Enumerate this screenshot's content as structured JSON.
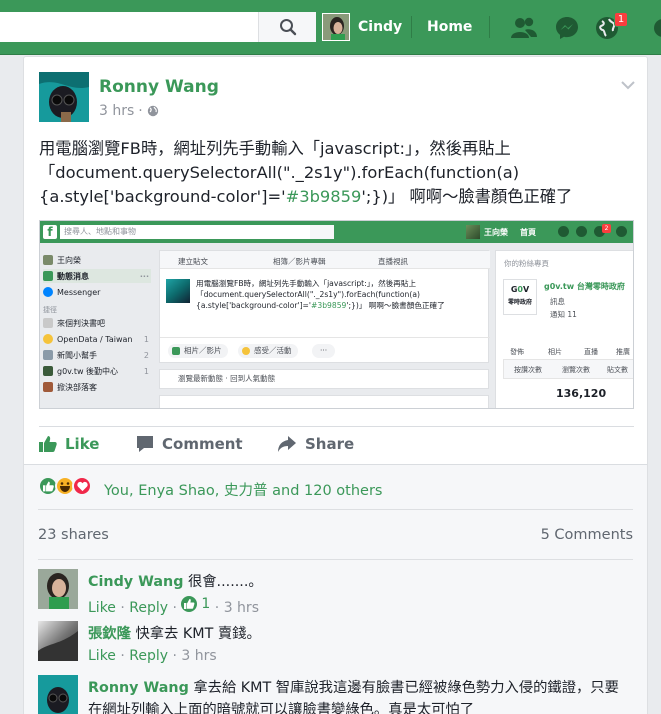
{
  "topbar": {
    "user_name": "Cindy",
    "home_label": "Home",
    "notification_count": "1"
  },
  "post": {
    "author": "Ronny Wang",
    "time": "3 hrs",
    "text_before": "用電腦瀏覽FB時，網址列先手動輸入「javascript:」，然後再貼上「document.querySelectorAll(\"._2s1y\").forEach(function(a){a.style['background-color']='",
    "text_color": "#3b9859",
    "text_after": "';})」 啊啊～臉書顏色正確了"
  },
  "embedded": {
    "search_placeholder": "搜尋人、地點和事物",
    "user_name": "王向榮",
    "home": "首頁",
    "badge": "2",
    "left_items": [
      {
        "label": "王向榮",
        "num": ""
      },
      {
        "label": "動態消息",
        "num": "···"
      },
      {
        "label": "Messenger",
        "num": ""
      },
      {
        "label": "捷徑",
        "num": ""
      },
      {
        "label": "來個判決書吧",
        "num": ""
      },
      {
        "label": "OpenData / Taiwan",
        "num": "1"
      },
      {
        "label": "新聞小幫手",
        "num": "2"
      },
      {
        "label": "g0v.tw 後勤中心",
        "num": "1"
      },
      {
        "label": "掀決部落客",
        "num": ""
      }
    ],
    "composer_tabs": [
      "建立貼文",
      "相簿／影片專輯",
      "直播視訊"
    ],
    "post_text_before": "用電腦瀏覽FB時，網址列先手動輸入「javascript:」，然後再貼上「document.querySelectorAll(\"._2s1y\").forEach(function(a){a.style['background-color']='",
    "post_text_color": "#3b9859",
    "post_text_after": "';})」 啊啊～臉書顏色正確了",
    "btn_photo": "相片／影片",
    "btn_feeling": "感受／活動",
    "btn_more": "···",
    "feed_option": "瀏覽最新動態 · 回到人氣動態",
    "right_header": "你的粉絲專頁",
    "page_logo": "G0V\n零時政府",
    "page_name": "g0v.tw 台灣零時政府",
    "page_category": "訊息",
    "page_notifications": "通知 11",
    "page_actions": [
      "發佈",
      "相片",
      "直播",
      "推廣"
    ],
    "stat_tabs": [
      "按讚次數",
      "瀏覽次數",
      "貼文數"
    ],
    "likes_count": "136,120"
  },
  "actions": {
    "like": "Like",
    "comment": "Comment",
    "share": "Share"
  },
  "reactions_text": "You, Enya Shao, 史力普 and 120 others",
  "shares": "23 shares",
  "comments_count": "5 Comments",
  "comments": [
    {
      "name": "Cindy Wang",
      "text": "很會.......。",
      "like": "Like",
      "reply": "Reply",
      "likes": "1",
      "time": "3 hrs"
    },
    {
      "name": "張欽隆",
      "text": "快拿去 KMT 賣錢。",
      "like": "Like",
      "reply": "Reply",
      "time": "3 hrs"
    },
    {
      "name": "Ronny Wang",
      "text": "拿去給 KMT 智庫說我這邊有臉書已經被綠色勢力入侵的鐵證，只要在網址列輸入上面的暗號就可以讓臉書變綠色。真是太可怕了"
    }
  ],
  "colors": {
    "brand": "#3b9859",
    "badge": "#fa3e3e"
  }
}
